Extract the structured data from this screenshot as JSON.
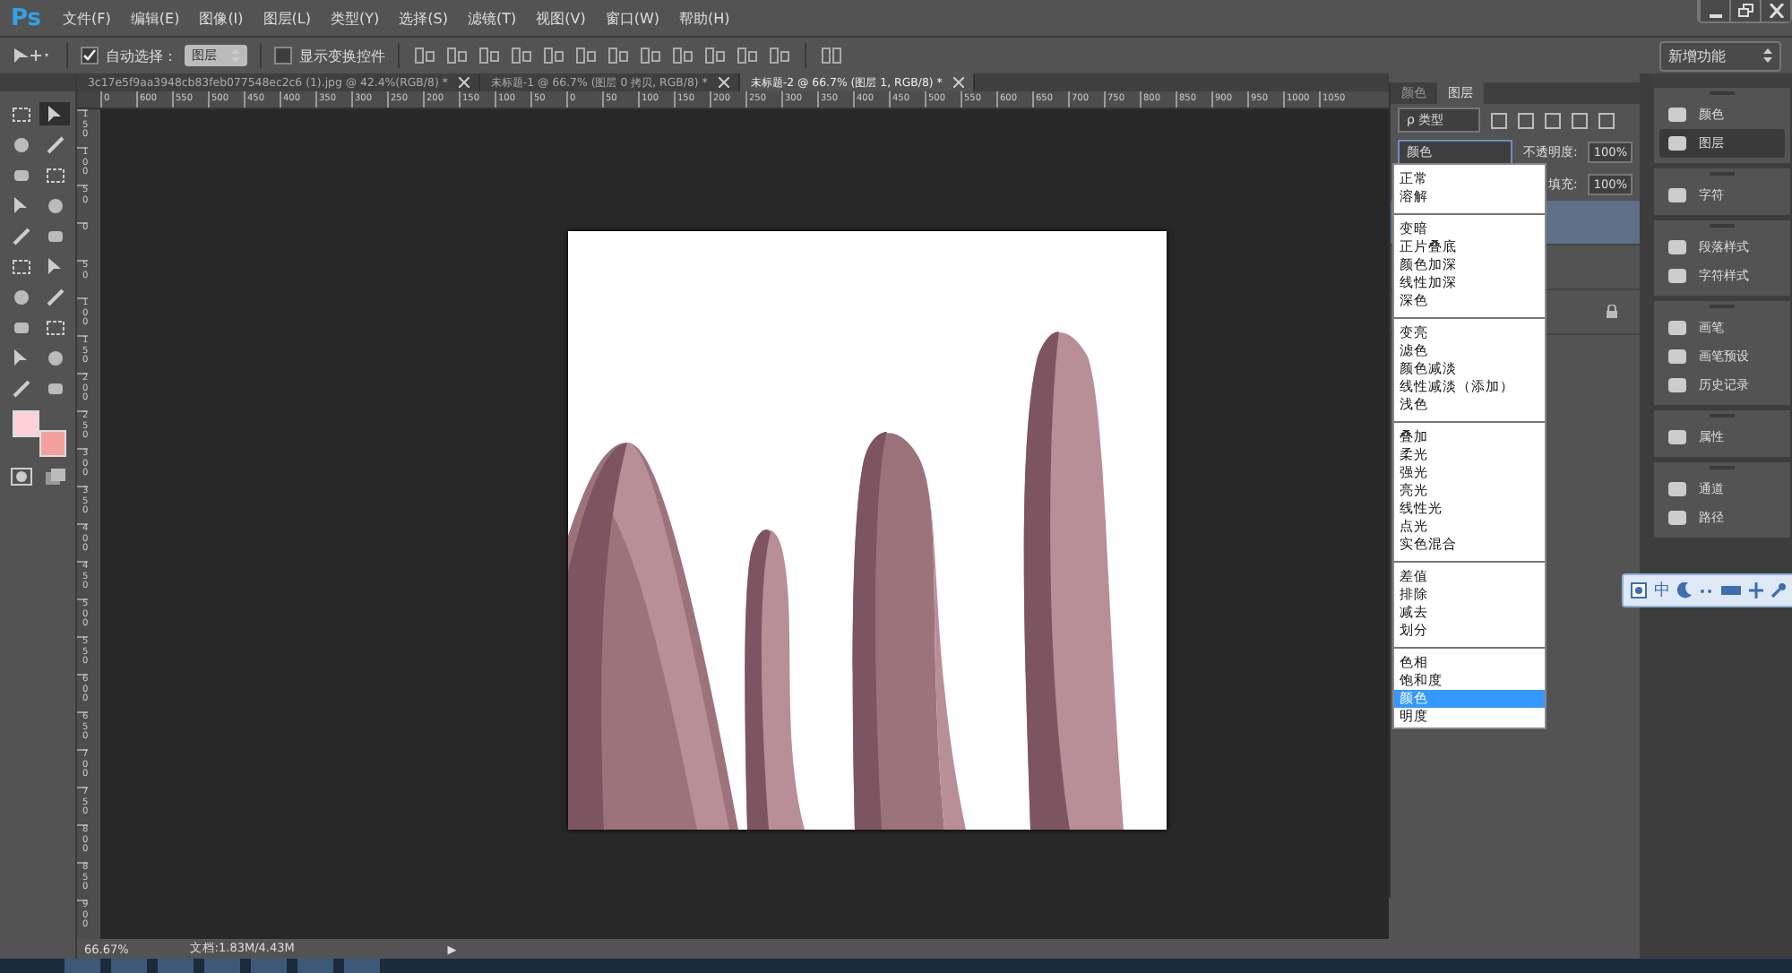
{
  "app_logo": "Ps",
  "menu": [
    "文件(F)",
    "编辑(E)",
    "图像(I)",
    "图层(L)",
    "类型(Y)",
    "选择(S)",
    "滤镜(T)",
    "视图(V)",
    "窗口(W)",
    "帮助(H)"
  ],
  "options_bar": {
    "auto_select": {
      "label": "自动选择：",
      "checked": true
    },
    "auto_select_target": "图层",
    "show_transform": {
      "label": "显示变换控件",
      "checked": false
    }
  },
  "workspace": "新增功能",
  "document_tabs": [
    {
      "title": "3c17e5f9aa3948cb83feb077548ec2c6 (1).jpg @ 42.4%(RGB/8) *",
      "selected": false
    },
    {
      "title": "未标题-1 @ 66.7% (图层 0 拷贝, RGB/8) *",
      "selected": false
    },
    {
      "title": "未标题-2 @ 66.7% (图层 1, RGB/8) *",
      "selected": true
    }
  ],
  "horizontal_ruler": [
    "0",
    "600",
    "550",
    "500",
    "450",
    "400",
    "350",
    "300",
    "250",
    "200",
    "150",
    "100",
    "50",
    "0",
    "50",
    "100",
    "150",
    "200",
    "250",
    "300",
    "350",
    "400",
    "450",
    "500",
    "550",
    "600",
    "650",
    "700",
    "750",
    "800",
    "850",
    "900",
    "950",
    "1000",
    "1050"
  ],
  "vertical_ruler": [
    "150",
    "100",
    "50",
    "0",
    "50",
    "100",
    "150",
    "200",
    "250",
    "300",
    "350",
    "400",
    "450",
    "500",
    "550",
    "600",
    "650",
    "700",
    "750",
    "800",
    "850",
    "900"
  ],
  "tools": [
    {
      "selected": false
    },
    {
      "selected": true
    },
    {
      "selected": false
    },
    {
      "selected": false
    },
    {
      "selected": false
    },
    {
      "selected": false
    },
    {
      "selected": false
    },
    {
      "selected": false
    },
    {
      "selected": false
    },
    {
      "selected": false
    },
    {
      "selected": false
    },
    {
      "selected": false
    },
    {
      "selected": false
    },
    {
      "selected": false
    },
    {
      "selected": false
    },
    {
      "selected": false
    },
    {
      "selected": false
    },
    {
      "selected": false
    },
    {
      "selected": false
    },
    {
      "selected": false
    }
  ],
  "layers_panel": {
    "tabs": [
      {
        "label": "颜色",
        "selected": false
      },
      {
        "label": "图层",
        "selected": true
      }
    ],
    "filter": "ρ 类型",
    "blend_mode": "颜色",
    "opacity_label": "不透明度:",
    "opacity": "100%",
    "fill_label": "填充:",
    "fill": "100%",
    "layers": [
      {
        "selected": true,
        "locked": false
      },
      {
        "selected": false,
        "locked": false
      },
      {
        "selected": false,
        "locked": true
      }
    ]
  },
  "blend_menu": [
    [
      {
        "label": "正常",
        "selected": false
      },
      {
        "label": "溶解",
        "selected": false
      }
    ],
    [
      {
        "label": "变暗",
        "selected": false
      },
      {
        "label": "正片叠底",
        "selected": false
      },
      {
        "label": "颜色加深",
        "selected": false
      },
      {
        "label": "线性加深",
        "selected": false
      },
      {
        "label": "深色",
        "selected": false
      }
    ],
    [
      {
        "label": "变亮",
        "selected": false
      },
      {
        "label": "滤色",
        "selected": false
      },
      {
        "label": "颜色减淡",
        "selected": false
      },
      {
        "label": "线性减淡（添加）",
        "selected": false
      },
      {
        "label": "浅色",
        "selected": false
      }
    ],
    [
      {
        "label": "叠加",
        "selected": false
      },
      {
        "label": "柔光",
        "selected": false
      },
      {
        "label": "强光",
        "selected": false
      },
      {
        "label": "亮光",
        "selected": false
      },
      {
        "label": "线性光",
        "selected": false
      },
      {
        "label": "点光",
        "selected": false
      },
      {
        "label": "实色混合",
        "selected": false
      }
    ],
    [
      {
        "label": "差值",
        "selected": false
      },
      {
        "label": "排除",
        "selected": false
      },
      {
        "label": "减去",
        "selected": false
      },
      {
        "label": "划分",
        "selected": false
      }
    ],
    [
      {
        "label": "色相",
        "selected": false
      },
      {
        "label": "饱和度",
        "selected": false
      },
      {
        "label": "颜色",
        "selected": true
      },
      {
        "label": "明度",
        "selected": false
      }
    ]
  ],
  "dock": [
    [
      {
        "label": "颜色",
        "selected": false
      },
      {
        "label": "图层",
        "selected": true
      }
    ],
    [
      {
        "label": "字符",
        "selected": false
      }
    ],
    [
      {
        "label": "段落样式",
        "selected": false
      },
      {
        "label": "字符样式",
        "selected": false
      }
    ],
    [
      {
        "label": "画笔",
        "selected": false
      },
      {
        "label": "画笔预设",
        "selected": false
      },
      {
        "label": "历史记录",
        "selected": false
      }
    ],
    [
      {
        "label": "属性",
        "selected": false
      }
    ],
    [
      {
        "label": "通道",
        "selected": false
      },
      {
        "label": "路径",
        "selected": false
      }
    ]
  ],
  "ime_toolbar": {
    "mode": "中"
  },
  "status_bar": {
    "zoom": "66.67%",
    "doc": "文档:1.83M/4.43M",
    "arrow": "▶"
  }
}
